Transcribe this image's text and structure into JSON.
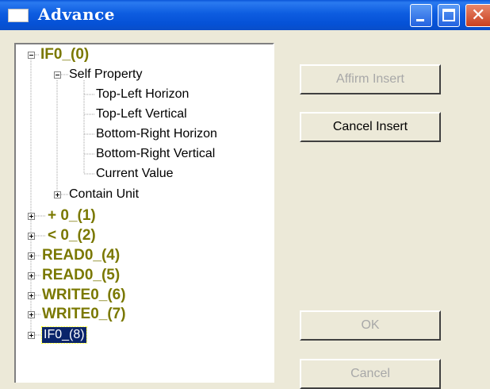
{
  "window": {
    "title": "Advance"
  },
  "tree": {
    "root_expanded": "IF0_(0)",
    "self_property": "Self Property",
    "self_children": [
      "Top-Left Horizon",
      "Top-Left Vertical",
      "Bottom-Right Horizon",
      "Bottom-Right Vertical",
      "Current Value"
    ],
    "contain_unit": "Contain Unit",
    "siblings": [
      "+ 0_(1)",
      "< 0_(2)",
      "READ0_(4)",
      "READ0_(5)",
      "WRITE0_(6)",
      "WRITE0_(7)"
    ],
    "selected": "IF0_(8)"
  },
  "buttons": {
    "affirm_insert": "Affirm Insert",
    "cancel_insert": "Cancel Insert",
    "ok": "OK",
    "cancel": "Cancel"
  },
  "colors": {
    "titlebar": "#0551d6",
    "root_text": "#7a7800",
    "selection": "#0a246a",
    "dialog_bg": "#ece9d8"
  }
}
